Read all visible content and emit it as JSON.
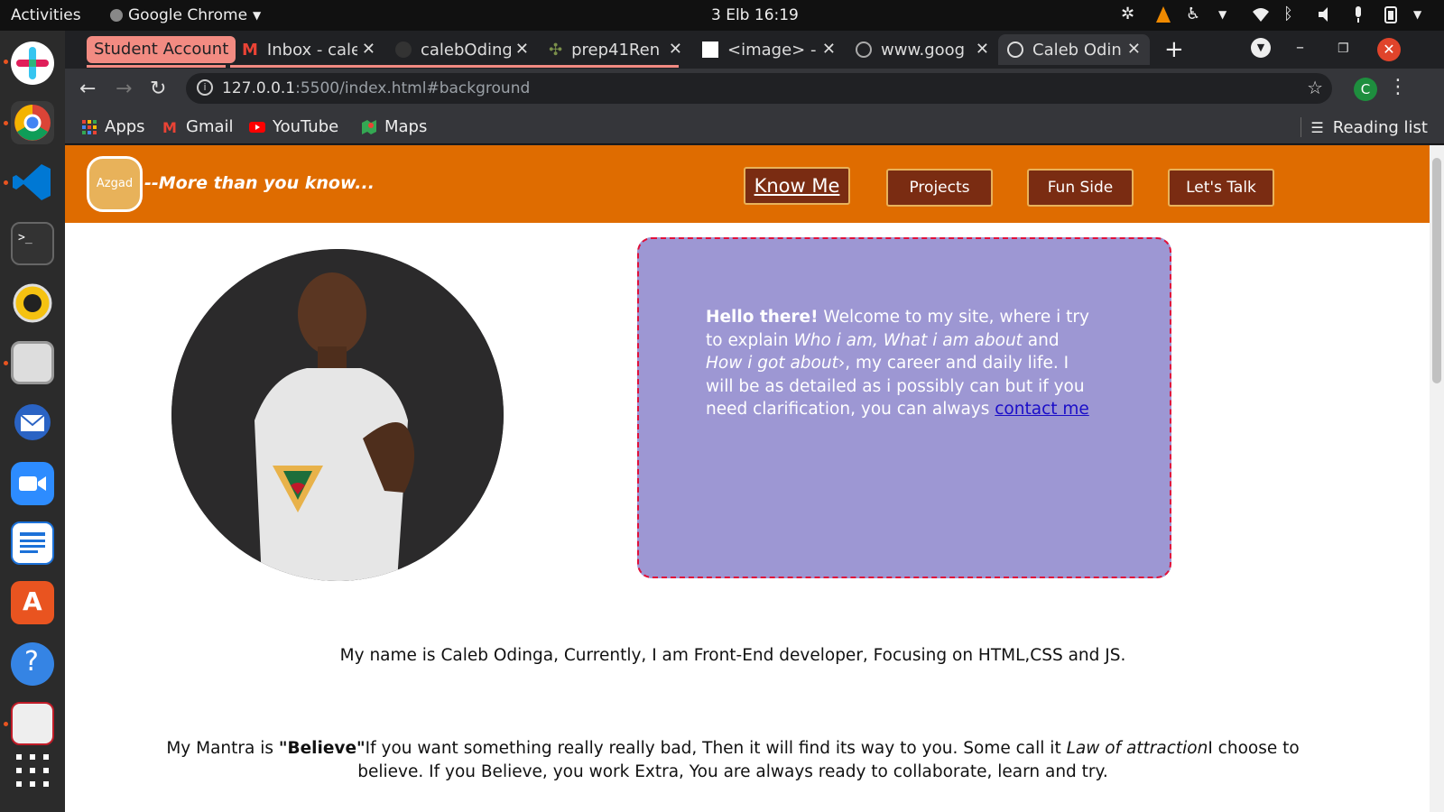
{
  "os": {
    "activities": "Activities",
    "app_name": "Google Chrome",
    "clock": "3 Elb  16:19"
  },
  "browser": {
    "profile_chip": "Student Account",
    "tabs": [
      {
        "title": "Inbox - cale"
      },
      {
        "title": "calebOding"
      },
      {
        "title": "prep41Ren"
      },
      {
        "title": "<image> - S"
      },
      {
        "title": "www.goog"
      },
      {
        "title": "Caleb Odin"
      }
    ],
    "url_host": "127.0.0.1",
    "url_path": ":5500/index.html#background",
    "avatar_letter": "C",
    "bookmarks": [
      "Apps",
      "Gmail",
      "YouTube",
      "Maps"
    ],
    "reading_list": "Reading list"
  },
  "site": {
    "logo": "Azgad",
    "tagline": "--More  than  you  know...",
    "nav": [
      "Know Me",
      "Projects",
      "Fun Side",
      "Let's Talk"
    ],
    "intro": {
      "greeting": "Hello there!",
      "p1": " Welcome to my site, where i try to explain ",
      "em1": "Who i am, What i am about",
      "p2": " and ",
      "em2": "How i got about",
      "p3": "›, my career and daily life. I will be as detailed as i possibly can but if you need clarification, you can always ",
      "link": "contact me"
    },
    "bio": "My name is Caleb Odinga, Currently, I am Front-End developer, Focusing on HTML,CSS and JS.",
    "mantra": {
      "p1": "My Mantra is ",
      "quote": "\"Believe\"",
      "p2": "If you want something really really bad, Then it will find its way to you. Some call it ",
      "em": "Law of attraction",
      "p3": "I choose to believe. If you Believe, you work Extra, You are always ready to collaborate, learn and try."
    }
  },
  "colors": {
    "header": "#df6c00",
    "nav_button": "#7a2c12",
    "card": "#9d97d3",
    "card_border": "#e0103a"
  }
}
